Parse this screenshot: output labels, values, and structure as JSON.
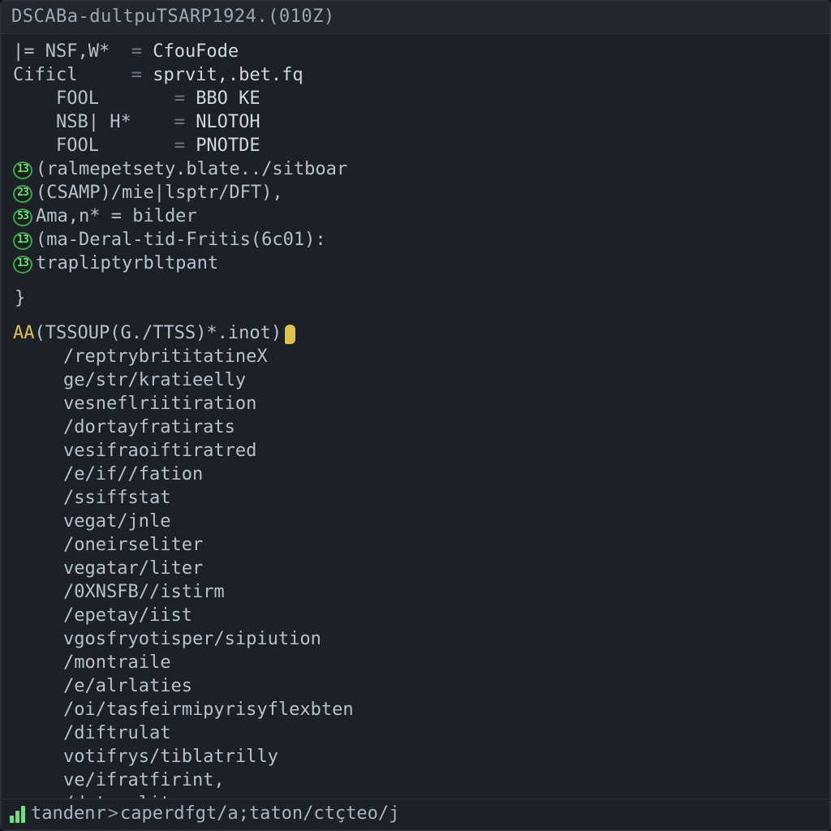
{
  "window": {
    "title": "DSCABa-dultpuTSARP1924.(010Z)"
  },
  "vars": [
    {
      "indent": "",
      "key": "|= NSF,W*",
      "padTo": 10,
      "eq": "=",
      "value": "CfouFode"
    },
    {
      "indent": "",
      "key": "Cificl",
      "padTo": 10,
      "eq": "=",
      "value": "sprvit,.bet.fq"
    },
    {
      "indent": "    ",
      "key": "FOOL",
      "padTo": 10,
      "eq": "=",
      "value": "BBO KE"
    },
    {
      "indent": "    ",
      "key": "NSB| H*",
      "padTo": 10,
      "eq": "=",
      "value": "NLOTOH"
    },
    {
      "indent": "    ",
      "key": "FOOL",
      "padTo": 10,
      "eq": "=",
      "value": "PNOTDE"
    }
  ],
  "markerLines": [
    {
      "badge": "13",
      "text": "(ralmepetsety.blate../sitboar"
    },
    {
      "badge": "23",
      "text": "(CSAMP)/mie|lsptr/DFT),"
    },
    {
      "badge": "53",
      "text": "Ama,n* = bilder"
    },
    {
      "badge": "13",
      "text": "(ma-Deral-tid-Fritis(6c01):"
    },
    {
      "badge": "13",
      "text": "trapliptyrbltpant"
    }
  ],
  "closing": "}",
  "secondHeader": {
    "prefix": "AA",
    "rest": "(TSSOUP(G./TTSS)*.inot)"
  },
  "list": [
    "/reptrybrititatineX",
    "ge/str/kratieelly",
    "vesneflriitiration",
    "/dortayfratirats",
    "vesifraoiftiratred",
    "/e/if//fation",
    "/ssiffstat",
    "vegat/jnle",
    "/oneirseliter",
    "vegatar/liter",
    "/0XNSFB//istirm",
    "/epetay/iist",
    "vgosfryotisper/sipiution",
    "/montraile",
    "/e/alrlaties",
    "/oi/tasfeirmipyrisyflexbten",
    "/diftrulat",
    "votifrys/tiblatrilly",
    "ve/ifratfirint,",
    "/detsraliters"
  ],
  "status": {
    "prompt": "tandenr",
    "sep": ">",
    "segments": [
      "caperdfgt",
      "a;taton",
      "ctçteo",
      "j"
    ]
  }
}
